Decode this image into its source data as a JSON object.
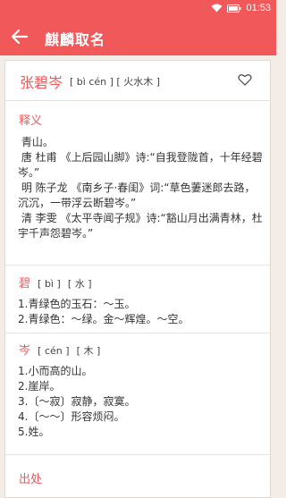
{
  "statusbar": {
    "time": "01:53",
    "wifi_icon": "wifi-icon",
    "battery_icon": "battery-icon"
  },
  "header": {
    "title": "麒麟取名",
    "back_icon": "back-arrow-icon"
  },
  "name_card": {
    "name": "张碧岑",
    "pinyin": "[ bì cén ]",
    "elements": "[ 火水木 ]",
    "favorite_icon": "heart-icon"
  },
  "meaning": {
    "title": "释义",
    "lines": [
      " 青山。",
      " 唐 杜甫 《上后园山脚》诗:“自我登陇首，十年经碧岑。”",
      " 明 陈子龙 《南乡子·春闺》词:“草色萋迷郎去路，沉沉，一带浮云断碧岑。”",
      " 清 李雯 《太平寺闻子规》诗:“豁山月出满青林，杜宇千声怨碧岑。”"
    ]
  },
  "char1": {
    "char": "碧",
    "pinyin": "[ bì ]",
    "element": "[ 水 ]",
    "lines": [
      "1.青绿色的玉石：～玉。",
      "2.青绿色：～绿。金～辉煌。～空。"
    ]
  },
  "char2": {
    "char": "岑",
    "pinyin": "[ cén ]",
    "element": "[ 木 ]",
    "lines": [
      "1.小而高的山。",
      "2.崖岸。",
      "3.〔～寂〕寂静，寂寞。",
      "4.〔～～〕形容烦闷。",
      "5.姓。"
    ]
  },
  "source": {
    "title": "出处"
  },
  "colors": {
    "accent": "#f0585a",
    "background": "#f3ece7"
  }
}
